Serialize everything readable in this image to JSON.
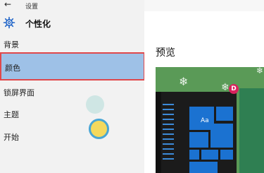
{
  "window": {
    "title": "设置",
    "back_icon": "←"
  },
  "section": {
    "title": "个性化",
    "icon": "gear-icon"
  },
  "nav_items": [
    {
      "label": "背景"
    },
    {
      "label": "颜色",
      "selected": true
    },
    {
      "label": "锁屏界面"
    },
    {
      "label": "主题"
    },
    {
      "label": "开始"
    }
  ],
  "main": {
    "preview_label": "预览",
    "tile_text": "Aa",
    "badge_letter": "D"
  },
  "colors": {
    "sidebar_bg": "#f2f2f2",
    "selected_bg": "#9ec1e7",
    "highlight_border": "#e0484b",
    "accent_tile": "#1b72d1"
  }
}
